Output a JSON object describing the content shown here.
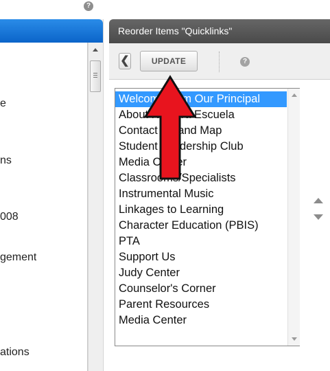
{
  "left_panel": {
    "items": [
      "e",
      "ns",
      "008",
      "gement",
      "ations"
    ]
  },
  "right_panel": {
    "title": "Reorder Items \"Quicklinks\"",
    "toolbar": {
      "back_glyph": "❮",
      "update_label": "UPDATE",
      "help_glyph": "?"
    },
    "list_items": [
      "Welcome from Our Principal",
      "About Nuestra Escuela",
      "Contact Us and Map",
      "Student Leadership Club",
      "Media Center",
      "Classrooms/Specialists",
      "Instrumental Music",
      "Linkages to Learning",
      "Character Education (PBIS)",
      "PTA",
      "Support Us",
      "Judy Center",
      "Counselor's Corner",
      "Parent Resources",
      "Media Center"
    ],
    "selected_index": 0
  },
  "top_help_glyph": "?",
  "colors": {
    "left_header": "#1677d9",
    "right_header": "#555555",
    "selection": "#3399ff",
    "annotation_arrow": "#e8141e"
  }
}
